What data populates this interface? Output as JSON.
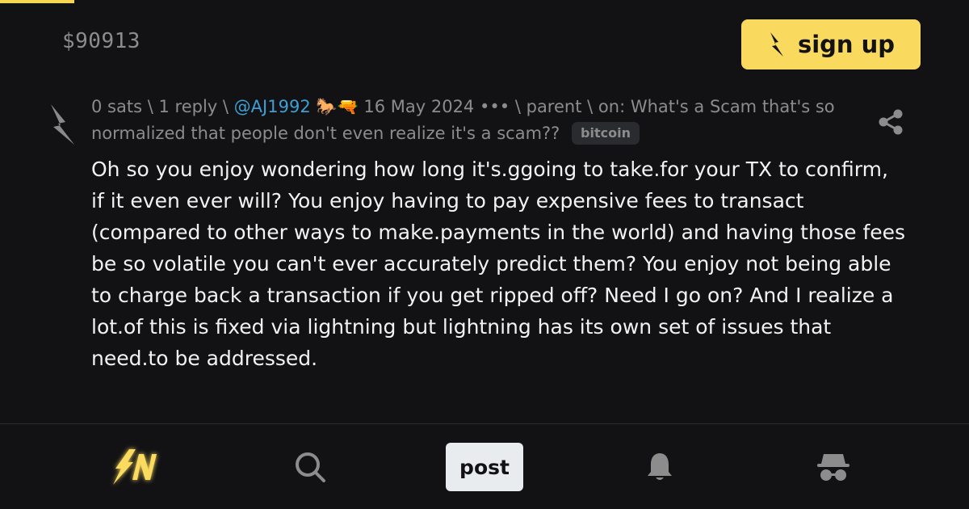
{
  "header": {
    "price": "$90913",
    "signup_label": "sign up"
  },
  "item": {
    "sats": "0 sats",
    "replies": "1 reply",
    "sep": "\\",
    "user": "@AJ1992",
    "user_emoji": "🐎🔫",
    "date": "16 May 2024",
    "more": "•••",
    "parent": "parent",
    "on_prefix": "on:",
    "parent_title": "What's a Scam that's so normalized that people don't even realize it's a scam??",
    "tag": "bitcoin",
    "body": "Oh so you enjoy wondering how long it's.ggoing to take.for your TX to confirm, if it even ever will? You enjoy having to pay expensive fees to transact (compared to other ways to make.payments in the world) and having those fees be so volatile you can't ever accurately predict them? You enjoy not being able to charge back a transaction if you get ripped off? Need I go on? And I realize a lot.of this is fixed via lightning but lightning has its own set of issues that need.to be addressed."
  },
  "nav": {
    "logo_icon": "sn-logo-icon",
    "search_icon": "search-icon",
    "post_label": "post",
    "bell_icon": "bell-icon",
    "anon_icon": "anon-icon"
  },
  "colors": {
    "background": "#121214",
    "accent": "#fada5e",
    "link": "#3e9fd4",
    "muted": "#8c8c8c"
  }
}
